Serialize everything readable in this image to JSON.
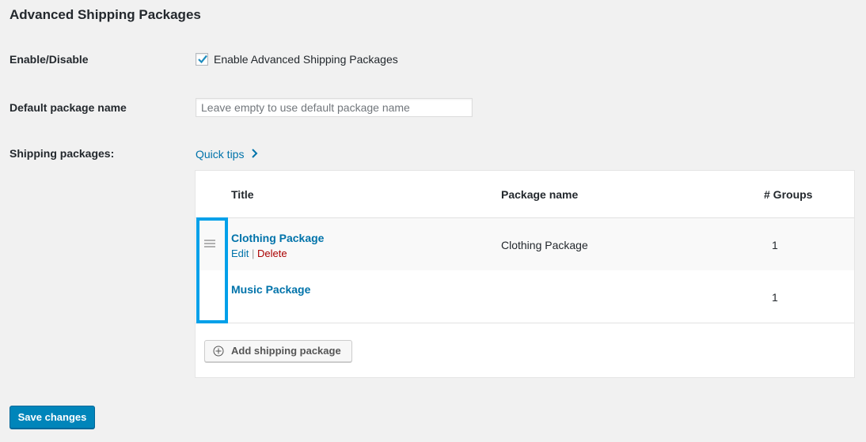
{
  "page_title": "Advanced Shipping Packages",
  "enable": {
    "label": "Enable/Disable",
    "checkbox_label": "Enable Advanced Shipping Packages",
    "checked": true
  },
  "default_name": {
    "label": "Default package name",
    "value": "",
    "placeholder": "Leave empty to use default package name"
  },
  "packages": {
    "label": "Shipping packages:",
    "quick_tips": "Quick tips",
    "columns": [
      "Title",
      "Package name",
      "# Groups"
    ],
    "rows": [
      {
        "title": "Clothing Package",
        "package_name": "Clothing Package",
        "groups": "1",
        "edit": "Edit",
        "sep": "|",
        "delete": "Delete"
      },
      {
        "title": "Music Package",
        "package_name": "",
        "groups": "1"
      }
    ],
    "add_button": "Add shipping package"
  },
  "save_button": "Save changes",
  "colors": {
    "accent": "#0073aa",
    "highlight": "#00a0e9",
    "delete": "#a00",
    "primary": "#0085ba"
  }
}
